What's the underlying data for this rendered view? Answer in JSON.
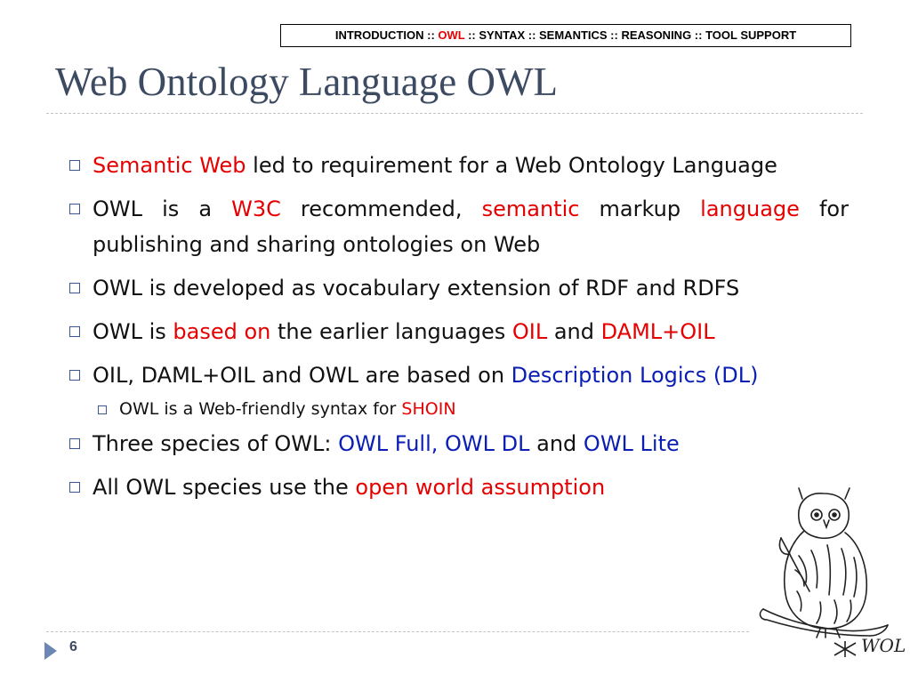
{
  "nav": {
    "prefix": "INTRODUCTION :: ",
    "current": "OWL",
    "suffix": " :: SYNTAX :: SEMANTICS :: REASONING :: TOOL SUPPORT"
  },
  "title": "Web Ontology Language OWL",
  "bullets": {
    "b1": {
      "t1": "Semantic Web",
      "t2": " led to requirement for a Web Ontology Language"
    },
    "b2": {
      "t1": "OWL is a ",
      "t2": "W3C",
      "t3": " recommended, ",
      "t4": "semantic",
      "t5": " markup ",
      "t6": "language",
      "t7": " for publishing and sharing ontologies on Web"
    },
    "b3": {
      "t1": "OWL is developed as vocabulary extension of RDF and RDFS"
    },
    "b4": {
      "t1": "OWL is ",
      "t2": "based on",
      "t3": " the earlier languages ",
      "t4": "OIL",
      "t5": " and ",
      "t6": "DAML+OIL"
    },
    "b5": {
      "t1": "OIL, DAML+OIL and OWL are based on ",
      "t2": "Description Logics (DL)"
    },
    "b5sub": {
      "t1": "OWL is a Web-friendly syntax for ",
      "t2": "SHOIN"
    },
    "b6": {
      "t1": "Three species of OWL: ",
      "t2": "OWL Full, OWL DL",
      "t3": " and ",
      "t4": "OWL Lite"
    },
    "b7": {
      "t1": "All OWL species use the ",
      "t2": "open world assumption"
    }
  },
  "footer": {
    "page_number": "6"
  },
  "owl_caption": "WOL",
  "colors": {
    "title": "#3c4a62",
    "highlight_red": "#e60000",
    "highlight_blue": "#0a1eb4",
    "bullet_box": "#3a5894"
  }
}
